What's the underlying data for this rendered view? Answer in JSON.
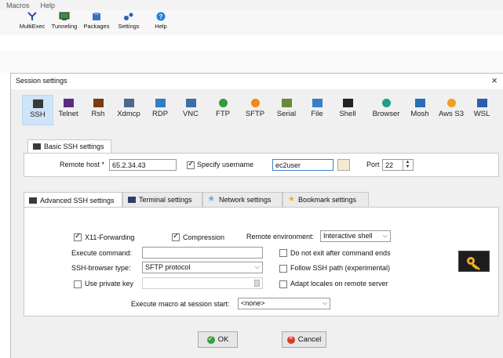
{
  "menubar": {
    "items": [
      "Macros",
      "Help"
    ]
  },
  "toolbar": {
    "items": [
      {
        "label": "MultiExec",
        "icon": "multiexec-icon"
      },
      {
        "label": "Tunneling",
        "icon": "tunneling-icon"
      },
      {
        "label": "Packages",
        "icon": "packages-icon"
      },
      {
        "label": "Settings",
        "icon": "settings-icon"
      },
      {
        "label": "Help",
        "icon": "help-icon"
      }
    ]
  },
  "dialog": {
    "title": "Session settings",
    "close": "×",
    "session_types": [
      {
        "label": "SSH",
        "icon": "ssh-icon",
        "color": "#3a3a3a",
        "active": true
      },
      {
        "label": "Telnet",
        "icon": "telnet-icon",
        "color": "#5b2d80"
      },
      {
        "label": "Rsh",
        "icon": "rsh-icon",
        "color": "#7a3b12"
      },
      {
        "label": "Xdmcp",
        "icon": "xdmcp-icon",
        "color": "#4a6a8a"
      },
      {
        "label": "RDP",
        "icon": "rdp-icon",
        "color": "#2f7fc4"
      },
      {
        "label": "VNC",
        "icon": "vnc-icon",
        "color": "#3c6fa8"
      },
      {
        "label": "FTP",
        "icon": "ftp-icon",
        "color": "#2f9e3a"
      },
      {
        "label": "SFTP",
        "icon": "sftp-icon",
        "color": "#f08a1a"
      },
      {
        "label": "Serial",
        "icon": "serial-icon",
        "color": "#6a8a3a"
      },
      {
        "label": "File",
        "icon": "file-icon",
        "color": "#3a7fc4"
      },
      {
        "label": "Shell",
        "icon": "shell-icon",
        "color": "#222222"
      },
      {
        "label": "Browser",
        "icon": "browser-icon",
        "color": "#1f9e8a"
      },
      {
        "label": "Mosh",
        "icon": "mosh-icon",
        "color": "#2c6fb5"
      },
      {
        "label": "Aws S3",
        "icon": "aws-s3-icon",
        "color": "#f0a020"
      },
      {
        "label": "WSL",
        "icon": "wsl-icon",
        "color": "#2a5fb0"
      }
    ],
    "basic": {
      "tab_label": "Basic SSH settings",
      "remote_host_label": "Remote host *",
      "remote_host_value": "65.2.34.43",
      "specify_username_label": "Specify username",
      "specify_username_checked": true,
      "username_value": "ec2user",
      "port_label": "Port",
      "port_value": "22"
    },
    "tabs": [
      {
        "label": "Advanced SSH settings",
        "icon": "advanced-ssh-icon",
        "active": true
      },
      {
        "label": "Terminal settings",
        "icon": "terminal-icon"
      },
      {
        "label": "Network settings",
        "icon": "network-icon"
      },
      {
        "label": "Bookmark settings",
        "icon": "star-icon"
      }
    ],
    "advanced": {
      "x11_label": "X11-Forwarding",
      "x11_checked": true,
      "compression_label": "Compression",
      "compression_checked": true,
      "remote_env_label": "Remote environment:",
      "remote_env_value": "Interactive shell",
      "exec_cmd_label": "Execute command:",
      "exec_cmd_value": "",
      "no_exit_label": "Do not exit after command ends",
      "browser_type_label": "SSH-browser type:",
      "browser_type_value": "SFTP protocol",
      "follow_path_label": "Follow SSH path (experimental)",
      "private_key_label": "Use private key",
      "private_key_value": "",
      "adapt_locales_label": "Adapt locales on remote server",
      "macro_label": "Execute macro at session start:",
      "macro_value": "<none>"
    },
    "buttons": {
      "ok": "OK",
      "cancel": "Cancel"
    }
  }
}
